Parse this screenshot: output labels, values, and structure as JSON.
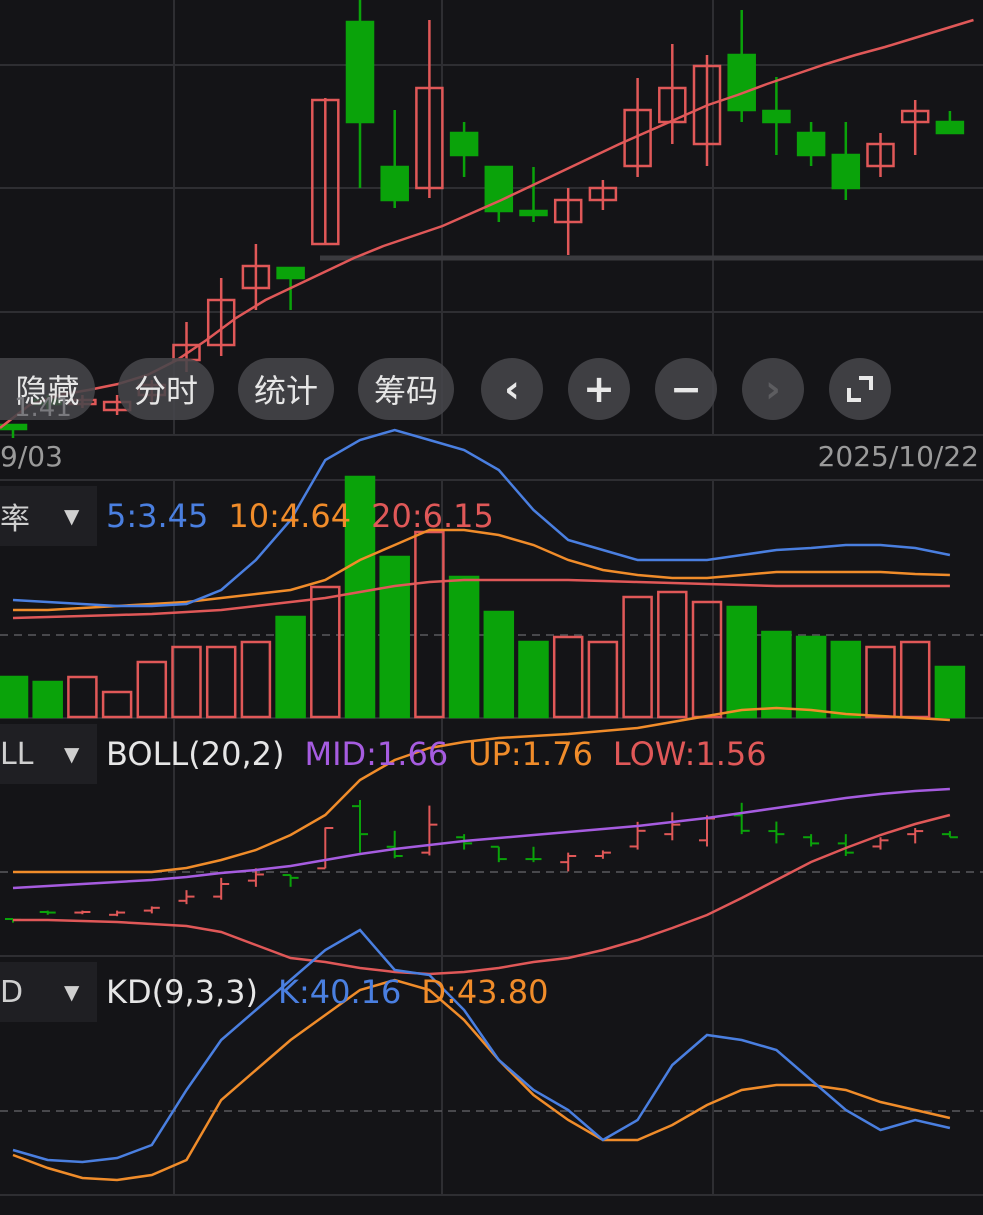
{
  "colors": {
    "background": "#141417",
    "grid": "#2e2e32",
    "up": "#e05858",
    "down": "#0aa30a",
    "ma5": "#4a7fe0",
    "ma10": "#f08c2a",
    "ma20": "#e05858",
    "boll_mid": "#a65ce0",
    "boll_up": "#f08c2a",
    "boll_low": "#e05858",
    "kd_k": "#4a7fe0",
    "kd_d": "#f08c2a"
  },
  "toolbar": {
    "hide_label": "隐藏",
    "timeshare_label": "分时",
    "stats_label": "统计",
    "chips_label": "筹码",
    "prev_icon": "chevron-left-icon",
    "zoom_in_icon": "plus-icon",
    "zoom_out_icon": "minus-icon",
    "next_icon": "chevron-right-icon",
    "fullscreen_icon": "fullscreen-icon"
  },
  "price_label": "1.41",
  "dates": {
    "start": "9/03",
    "end": "2025/10/22"
  },
  "panels": {
    "turnover": {
      "selector_label": "率",
      "ma5": "5:3.45",
      "ma10": "10:4.64",
      "ma20": "20:6.15"
    },
    "boll": {
      "selector_label": "LL",
      "name": "BOLL(20,2)",
      "mid": "MID:1.66",
      "up": "UP:1.76",
      "low": "LOW:1.56"
    },
    "kd": {
      "selector_label": "D",
      "name": "KD(9,3,3)",
      "k": "K:40.16",
      "d": "D:43.80"
    }
  },
  "chart_data": {
    "type": "candlestick",
    "candles": [
      {
        "o": 425,
        "h": 425,
        "l": 438,
        "c": 428
      },
      {
        "o": 400,
        "h": 395,
        "l": 410,
        "c": 402
      },
      {
        "o": 402,
        "h": 395,
        "l": 408,
        "c": 400
      },
      {
        "o": 410,
        "h": 395,
        "l": 415,
        "c": 402
      },
      {
        "o": 395,
        "h": 380,
        "l": 405,
        "c": 385
      },
      {
        "o": 360,
        "h": 322,
        "l": 372,
        "c": 345
      },
      {
        "o": 345,
        "h": 278,
        "l": 356,
        "c": 300
      },
      {
        "o": 288,
        "h": 244,
        "l": 310,
        "c": 266
      },
      {
        "o": 268,
        "h": 268,
        "l": 310,
        "c": 278
      },
      {
        "o": 244,
        "h": 98,
        "l": 244,
        "c": 100
      },
      {
        "o": 22,
        "h": 0,
        "l": 188,
        "c": 122
      },
      {
        "o": 167,
        "h": 110,
        "l": 208,
        "c": 200
      },
      {
        "o": 188,
        "h": 20,
        "l": 198,
        "c": 88
      },
      {
        "o": 133,
        "h": 122,
        "l": 177,
        "c": 155
      },
      {
        "o": 167,
        "h": 167,
        "l": 222,
        "c": 211
      },
      {
        "o": 211,
        "h": 167,
        "l": 222,
        "c": 211
      },
      {
        "o": 222,
        "h": 188,
        "l": 255,
        "c": 200
      },
      {
        "o": 200,
        "h": 180,
        "l": 210,
        "c": 188
      },
      {
        "o": 166,
        "h": 78,
        "l": 177,
        "c": 110
      },
      {
        "o": 122,
        "h": 44,
        "l": 144,
        "c": 88
      },
      {
        "o": 144,
        "h": 55,
        "l": 166,
        "c": 66
      },
      {
        "o": 55,
        "h": 10,
        "l": 122,
        "c": 110
      },
      {
        "o": 111,
        "h": 77,
        "l": 155,
        "c": 122
      },
      {
        "o": 133,
        "h": 122,
        "l": 166,
        "c": 155
      },
      {
        "o": 155,
        "h": 122,
        "l": 200,
        "c": 188
      },
      {
        "o": 166,
        "h": 133,
        "l": 177,
        "c": 144
      },
      {
        "o": 122,
        "h": 100,
        "l": 155,
        "c": 111
      },
      {
        "o": 122,
        "h": 111,
        "l": 133,
        "c": 133
      }
    ],
    "ma_price": [
      428,
      405,
      395,
      390,
      384,
      375,
      360,
      340,
      318,
      300,
      286,
      272,
      258,
      246,
      236,
      226,
      213,
      200,
      186,
      172,
      158,
      144,
      131,
      118,
      105,
      95,
      84,
      74,
      64,
      55,
      47,
      38,
      29,
      20
    ],
    "turnover": {
      "ma5": [
        600,
        602,
        604,
        606,
        606,
        604,
        590,
        560,
        520,
        460,
        440,
        430,
        440,
        450,
        470,
        510,
        540,
        550,
        560,
        560,
        560,
        555,
        550,
        548,
        545,
        545,
        548,
        555
      ],
      "ma10": [
        610,
        610,
        608,
        606,
        604,
        602,
        598,
        594,
        590,
        580,
        560,
        545,
        530,
        530,
        535,
        545,
        560,
        570,
        575,
        578,
        578,
        575,
        572,
        572,
        572,
        572,
        574,
        575
      ],
      "ma20": [
        618,
        617,
        616,
        615,
        614,
        612,
        610,
        606,
        602,
        598,
        592,
        586,
        582,
        580,
        580,
        580,
        580,
        581,
        582,
        583,
        584,
        585,
        586,
        586,
        586,
        586,
        586,
        586
      ],
      "bars": [
        40,
        35,
        40,
        25,
        55,
        70,
        70,
        75,
        100,
        130,
        240,
        160,
        185,
        140,
        105,
        75,
        80,
        75,
        120,
        125,
        115,
        110,
        85,
        80,
        75,
        70,
        75,
        50
      ]
    },
    "boll": {
      "mid": [
        888,
        886,
        884,
        882,
        880,
        877,
        873,
        870,
        866,
        860,
        854,
        849,
        845,
        841,
        838,
        835,
        832,
        829,
        826,
        822,
        818,
        813,
        808,
        803,
        798,
        794,
        791,
        789
      ],
      "up": [
        872,
        872,
        872,
        872,
        872,
        868,
        860,
        850,
        835,
        815,
        780,
        760,
        748,
        742,
        738,
        736,
        734,
        731,
        728,
        722,
        716,
        710,
        708,
        710,
        714,
        716,
        718,
        720
      ],
      "low": [
        920,
        920,
        921,
        922,
        924,
        926,
        932,
        945,
        958,
        962,
        968,
        972,
        974,
        972,
        968,
        962,
        958,
        950,
        940,
        928,
        915,
        898,
        880,
        862,
        848,
        835,
        824,
        815
      ]
    },
    "kd": {
      "k": [
        1150,
        1160,
        1162,
        1158,
        1145,
        1090,
        1040,
        1010,
        980,
        950,
        930,
        970,
        975,
        1010,
        1060,
        1090,
        1110,
        1140,
        1120,
        1065,
        1035,
        1040,
        1050,
        1080,
        1110,
        1130,
        1120,
        1128
      ],
      "d": [
        1155,
        1168,
        1178,
        1180,
        1175,
        1160,
        1100,
        1070,
        1040,
        1015,
        990,
        980,
        990,
        1020,
        1060,
        1095,
        1120,
        1140,
        1140,
        1125,
        1105,
        1090,
        1085,
        1085,
        1090,
        1102,
        1110,
        1118
      ]
    }
  }
}
